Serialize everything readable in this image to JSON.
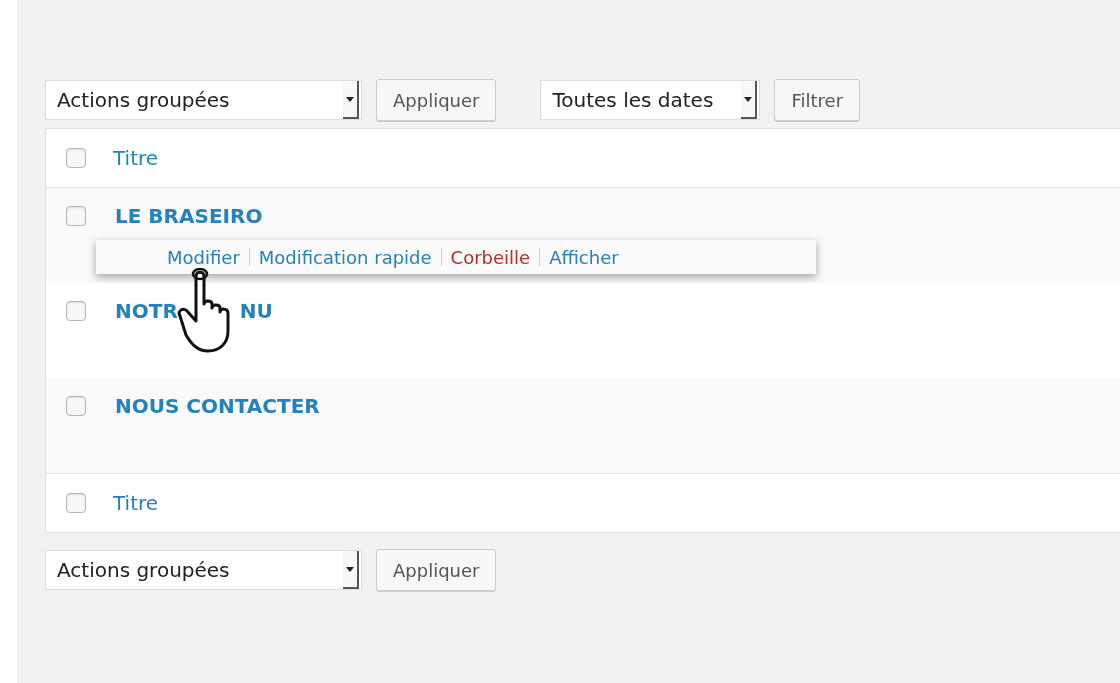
{
  "top_toolbar": {
    "bulk_select": "Actions groupées",
    "apply_button": "Appliquer",
    "date_select": "Toutes les dates",
    "filter_button": "Filtrer"
  },
  "table": {
    "header": {
      "checked": false,
      "label": "Titre"
    },
    "rows": [
      {
        "title": "LE BRASEIRO",
        "checked": false,
        "hovered": true,
        "actions": [
          {
            "label": "Modifier",
            "kind": "link"
          },
          {
            "label": "Modification rapide",
            "kind": "link"
          },
          {
            "label": "Corbeille",
            "kind": "danger"
          },
          {
            "label": "Afficher",
            "kind": "link"
          }
        ]
      },
      {
        "title": "NOTR",
        "title_tail": "NU",
        "checked": false,
        "hovered": false
      },
      {
        "title": "NOUS CONTACTER",
        "checked": false,
        "hovered": false
      }
    ],
    "footer": {
      "checked": false,
      "label": "Titre"
    }
  },
  "bottom_toolbar": {
    "bulk_select": "Actions groupées",
    "apply_button": "Appliquer"
  }
}
